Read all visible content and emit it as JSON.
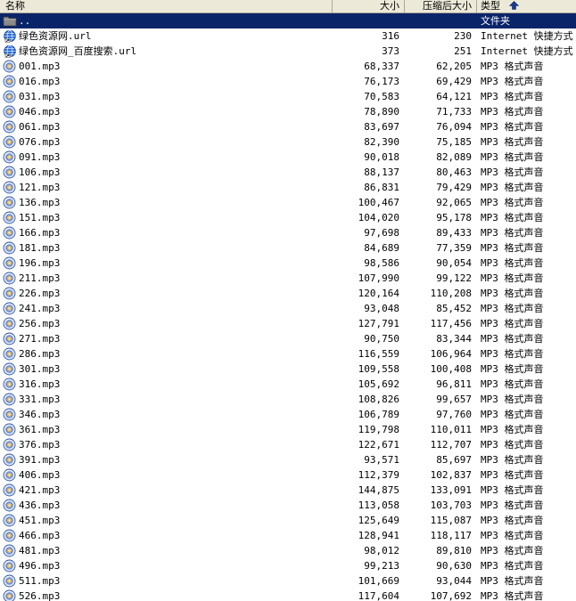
{
  "header": {
    "name": "名称",
    "size": "大小",
    "packed": "压缩后大小",
    "type": "类型",
    "sort_icon": "sort-up-arrow-icon"
  },
  "colors": {
    "selection": "#0a246a",
    "header_bg": "#ece9d8"
  },
  "rows": [
    {
      "name": "..",
      "size": "",
      "packed": "",
      "type": "文件夹",
      "icon": "folder-up-icon",
      "selected": true
    },
    {
      "name": "绿色资源网.url",
      "size": "316",
      "packed": "230",
      "type": "Internet 快捷方式",
      "icon": "url-icon"
    },
    {
      "name": "绿色资源网_百度搜索.url",
      "size": "373",
      "packed": "251",
      "type": "Internet 快捷方式",
      "icon": "url-icon"
    },
    {
      "name": "001.mp3",
      "size": "68,337",
      "packed": "62,205",
      "type": "MP3 格式声音",
      "icon": "mp3-icon"
    },
    {
      "name": "016.mp3",
      "size": "76,173",
      "packed": "69,429",
      "type": "MP3 格式声音",
      "icon": "mp3-icon"
    },
    {
      "name": "031.mp3",
      "size": "70,583",
      "packed": "64,121",
      "type": "MP3 格式声音",
      "icon": "mp3-icon"
    },
    {
      "name": "046.mp3",
      "size": "78,890",
      "packed": "71,733",
      "type": "MP3 格式声音",
      "icon": "mp3-icon"
    },
    {
      "name": "061.mp3",
      "size": "83,697",
      "packed": "76,094",
      "type": "MP3 格式声音",
      "icon": "mp3-icon"
    },
    {
      "name": "076.mp3",
      "size": "82,390",
      "packed": "75,185",
      "type": "MP3 格式声音",
      "icon": "mp3-icon"
    },
    {
      "name": "091.mp3",
      "size": "90,018",
      "packed": "82,089",
      "type": "MP3 格式声音",
      "icon": "mp3-icon"
    },
    {
      "name": "106.mp3",
      "size": "88,137",
      "packed": "80,463",
      "type": "MP3 格式声音",
      "icon": "mp3-icon"
    },
    {
      "name": "121.mp3",
      "size": "86,831",
      "packed": "79,429",
      "type": "MP3 格式声音",
      "icon": "mp3-icon"
    },
    {
      "name": "136.mp3",
      "size": "100,467",
      "packed": "92,065",
      "type": "MP3 格式声音",
      "icon": "mp3-icon"
    },
    {
      "name": "151.mp3",
      "size": "104,020",
      "packed": "95,178",
      "type": "MP3 格式声音",
      "icon": "mp3-icon"
    },
    {
      "name": "166.mp3",
      "size": "97,698",
      "packed": "89,433",
      "type": "MP3 格式声音",
      "icon": "mp3-icon"
    },
    {
      "name": "181.mp3",
      "size": "84,689",
      "packed": "77,359",
      "type": "MP3 格式声音",
      "icon": "mp3-icon"
    },
    {
      "name": "196.mp3",
      "size": "98,586",
      "packed": "90,054",
      "type": "MP3 格式声音",
      "icon": "mp3-icon"
    },
    {
      "name": "211.mp3",
      "size": "107,990",
      "packed": "99,122",
      "type": "MP3 格式声音",
      "icon": "mp3-icon"
    },
    {
      "name": "226.mp3",
      "size": "120,164",
      "packed": "110,208",
      "type": "MP3 格式声音",
      "icon": "mp3-icon"
    },
    {
      "name": "241.mp3",
      "size": "93,048",
      "packed": "85,452",
      "type": "MP3 格式声音",
      "icon": "mp3-icon"
    },
    {
      "name": "256.mp3",
      "size": "127,791",
      "packed": "117,456",
      "type": "MP3 格式声音",
      "icon": "mp3-icon"
    },
    {
      "name": "271.mp3",
      "size": "90,750",
      "packed": "83,344",
      "type": "MP3 格式声音",
      "icon": "mp3-icon"
    },
    {
      "name": "286.mp3",
      "size": "116,559",
      "packed": "106,964",
      "type": "MP3 格式声音",
      "icon": "mp3-icon"
    },
    {
      "name": "301.mp3",
      "size": "109,558",
      "packed": "100,408",
      "type": "MP3 格式声音",
      "icon": "mp3-icon"
    },
    {
      "name": "316.mp3",
      "size": "105,692",
      "packed": "96,811",
      "type": "MP3 格式声音",
      "icon": "mp3-icon"
    },
    {
      "name": "331.mp3",
      "size": "108,826",
      "packed": "99,657",
      "type": "MP3 格式声音",
      "icon": "mp3-icon"
    },
    {
      "name": "346.mp3",
      "size": "106,789",
      "packed": "97,760",
      "type": "MP3 格式声音",
      "icon": "mp3-icon"
    },
    {
      "name": "361.mp3",
      "size": "119,798",
      "packed": "110,011",
      "type": "MP3 格式声音",
      "icon": "mp3-icon"
    },
    {
      "name": "376.mp3",
      "size": "122,671",
      "packed": "112,707",
      "type": "MP3 格式声音",
      "icon": "mp3-icon"
    },
    {
      "name": "391.mp3",
      "size": "93,571",
      "packed": "85,697",
      "type": "MP3 格式声音",
      "icon": "mp3-icon"
    },
    {
      "name": "406.mp3",
      "size": "112,379",
      "packed": "102,837",
      "type": "MP3 格式声音",
      "icon": "mp3-icon"
    },
    {
      "name": "421.mp3",
      "size": "144,875",
      "packed": "133,091",
      "type": "MP3 格式声音",
      "icon": "mp3-icon"
    },
    {
      "name": "436.mp3",
      "size": "113,058",
      "packed": "103,703",
      "type": "MP3 格式声音",
      "icon": "mp3-icon"
    },
    {
      "name": "451.mp3",
      "size": "125,649",
      "packed": "115,087",
      "type": "MP3 格式声音",
      "icon": "mp3-icon"
    },
    {
      "name": "466.mp3",
      "size": "128,941",
      "packed": "118,117",
      "type": "MP3 格式声音",
      "icon": "mp3-icon"
    },
    {
      "name": "481.mp3",
      "size": "98,012",
      "packed": "89,810",
      "type": "MP3 格式声音",
      "icon": "mp3-icon"
    },
    {
      "name": "496.mp3",
      "size": "99,213",
      "packed": "90,630",
      "type": "MP3 格式声音",
      "icon": "mp3-icon"
    },
    {
      "name": "511.mp3",
      "size": "101,669",
      "packed": "93,044",
      "type": "MP3 格式声音",
      "icon": "mp3-icon"
    },
    {
      "name": "526.mp3",
      "size": "117,604",
      "packed": "107,692",
      "type": "MP3 格式声音",
      "icon": "mp3-icon"
    }
  ]
}
